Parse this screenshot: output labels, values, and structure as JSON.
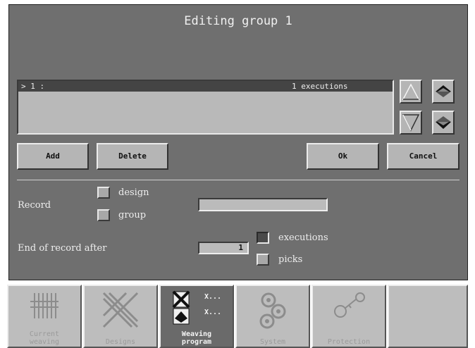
{
  "dialog": {
    "title": "Editing group 1"
  },
  "list": {
    "rows": [
      {
        "marker": "> 1 :",
        "executions": "1 executions"
      }
    ]
  },
  "icons": {
    "scroll_up": "triangle-up-outline-icon",
    "page_up": "double-chevron-up-icon",
    "scroll_down": "triangle-down-outline-icon",
    "page_down": "double-chevron-down-icon"
  },
  "buttons": {
    "add": "Add",
    "delete": "Delete",
    "ok": "Ok",
    "cancel": "Cancel"
  },
  "record": {
    "label": "Record",
    "option_design": "design",
    "option_group": "group",
    "name_value": ""
  },
  "end_of_record": {
    "label": "End of record after",
    "value": "1",
    "option_executions": "executions",
    "option_picks": "picks"
  },
  "tabs": [
    {
      "label_line1": "Current",
      "label_line2": "weaving",
      "active": false
    },
    {
      "label_line1": "Designs",
      "label_line2": "",
      "active": false
    },
    {
      "label_line1": "Weaving",
      "label_line2": "program",
      "active": true
    },
    {
      "label_line1": "System",
      "label_line2": "",
      "active": false
    },
    {
      "label_line1": "Protection",
      "label_line2": "",
      "active": false
    },
    {
      "label_line1": "",
      "label_line2": "",
      "active": false
    }
  ],
  "tab_icon_marks": "X..."
}
